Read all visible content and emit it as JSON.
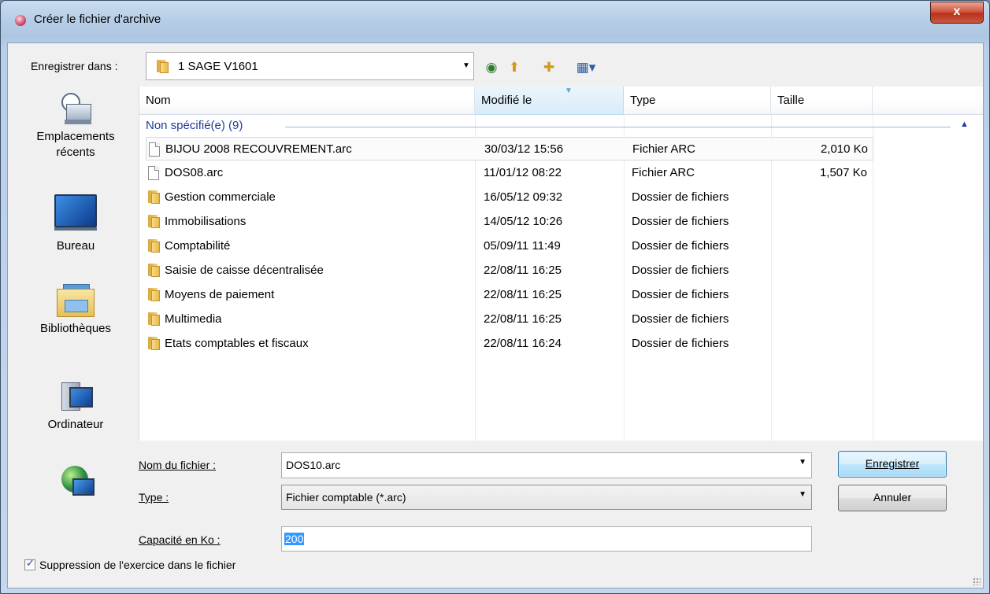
{
  "window": {
    "title": "Créer le fichier d'archive",
    "close_label": "x"
  },
  "location": {
    "label": "Enregistrer dans :",
    "value": "1 SAGE V1601"
  },
  "places": [
    {
      "label_line1": "Emplacements",
      "label_line2": "récents"
    },
    {
      "label_line1": "Bureau",
      "label_line2": ""
    },
    {
      "label_line1": "Bibliothèques",
      "label_line2": ""
    },
    {
      "label_line1": "Ordinateur",
      "label_line2": ""
    }
  ],
  "columns": {
    "name": "Nom",
    "modified": "Modifié le",
    "type": "Type",
    "size": "Taille"
  },
  "group": {
    "label": "Non spécifié(e) (9)"
  },
  "files": [
    {
      "name": "BIJOU 2008 RECOUVREMENT.arc",
      "date": "30/03/12 15:56",
      "type": "Fichier ARC",
      "size": "2,010 Ko",
      "kind": "file"
    },
    {
      "name": "DOS08.arc",
      "date": "11/01/12 08:22",
      "type": "Fichier ARC",
      "size": "1,507 Ko",
      "kind": "file"
    },
    {
      "name": "Gestion commerciale",
      "date": "16/05/12 09:32",
      "type": "Dossier de fichiers",
      "size": "",
      "kind": "folder"
    },
    {
      "name": "Immobilisations",
      "date": "14/05/12 10:26",
      "type": "Dossier de fichiers",
      "size": "",
      "kind": "folder"
    },
    {
      "name": "Comptabilité",
      "date": "05/09/11 11:49",
      "type": "Dossier de fichiers",
      "size": "",
      "kind": "folder"
    },
    {
      "name": "Saisie de caisse décentralisée",
      "date": "22/08/11 16:25",
      "type": "Dossier de fichiers",
      "size": "",
      "kind": "folder"
    },
    {
      "name": "Moyens de paiement",
      "date": "22/08/11 16:25",
      "type": "Dossier de fichiers",
      "size": "",
      "kind": "folder"
    },
    {
      "name": "Multimedia",
      "date": "22/08/11 16:25",
      "type": "Dossier de fichiers",
      "size": "",
      "kind": "folder"
    },
    {
      "name": "Etats comptables et fiscaux",
      "date": "22/08/11 16:24",
      "type": "Dossier de fichiers",
      "size": "",
      "kind": "folder"
    }
  ],
  "form": {
    "filename_label": "Nom du fichier :",
    "filename_value": "DOS10.arc",
    "type_label": "Type :",
    "type_value": "Fichier comptable (*.arc)",
    "capacity_label": "Capacité en Ko :",
    "capacity_value": "200",
    "suppress_label": "Suppression de l'exercice dans le fichier",
    "suppress_checked": true
  },
  "buttons": {
    "save": "Enregistrer",
    "cancel": "Annuler"
  }
}
